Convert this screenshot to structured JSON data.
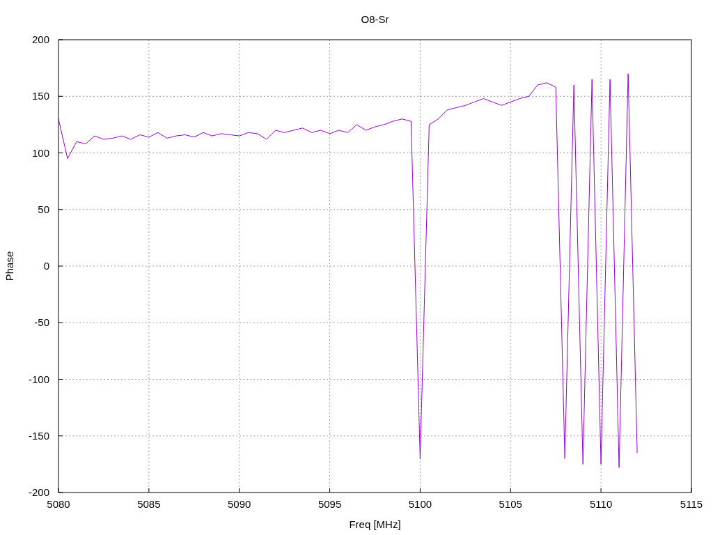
{
  "chart_data": {
    "type": "line",
    "title": "O8-Sr",
    "xlabel": "Freq [MHz]",
    "ylabel": "Phase",
    "x": [
      5080,
      5080.5,
      5081,
      5081.5,
      5082,
      5082.5,
      5083,
      5083.5,
      5084,
      5084.5,
      5085,
      5085.5,
      5086,
      5086.5,
      5087,
      5087.5,
      5088,
      5088.5,
      5089,
      5089.5,
      5090,
      5090.5,
      5091,
      5091.5,
      5092,
      5092.5,
      5093,
      5093.5,
      5094,
      5094.5,
      5095,
      5095.5,
      5096,
      5096.5,
      5097,
      5097.5,
      5098,
      5098.5,
      5099,
      5099.5,
      5100,
      5100.5,
      5101,
      5101.5,
      5102,
      5102.5,
      5103,
      5103.5,
      5104,
      5104.5,
      5105,
      5105.5,
      5106,
      5106.5,
      5107,
      5107.5,
      5108,
      5108.5,
      5109,
      5109.5,
      5110,
      5110.5,
      5111,
      5111.5,
      5112
    ],
    "series": [
      {
        "color": "#9400d3",
        "values": [
          130,
          95,
          110,
          108,
          115,
          112,
          113,
          115,
          112,
          116,
          114,
          118,
          113,
          115,
          116,
          114,
          118,
          115,
          117,
          116,
          115,
          118,
          117,
          112,
          120,
          118,
          120,
          122,
          118,
          120,
          117,
          120,
          118,
          125,
          120,
          123,
          125,
          128,
          130,
          128,
          -170,
          125,
          130,
          138,
          140,
          142,
          145,
          148,
          145,
          142,
          145,
          148,
          150,
          160,
          162,
          158,
          -170,
          160,
          -175,
          165,
          -175,
          165,
          -178,
          170,
          -165
        ]
      }
    ],
    "xlim": [
      5080,
      5115
    ],
    "ylim": [
      -200,
      200
    ],
    "xticks": [
      5080,
      5085,
      5090,
      5095,
      5100,
      5105,
      5110,
      5115
    ],
    "yticks": [
      -200,
      -150,
      -100,
      -50,
      0,
      50,
      100,
      150,
      200
    ],
    "grid": true
  }
}
